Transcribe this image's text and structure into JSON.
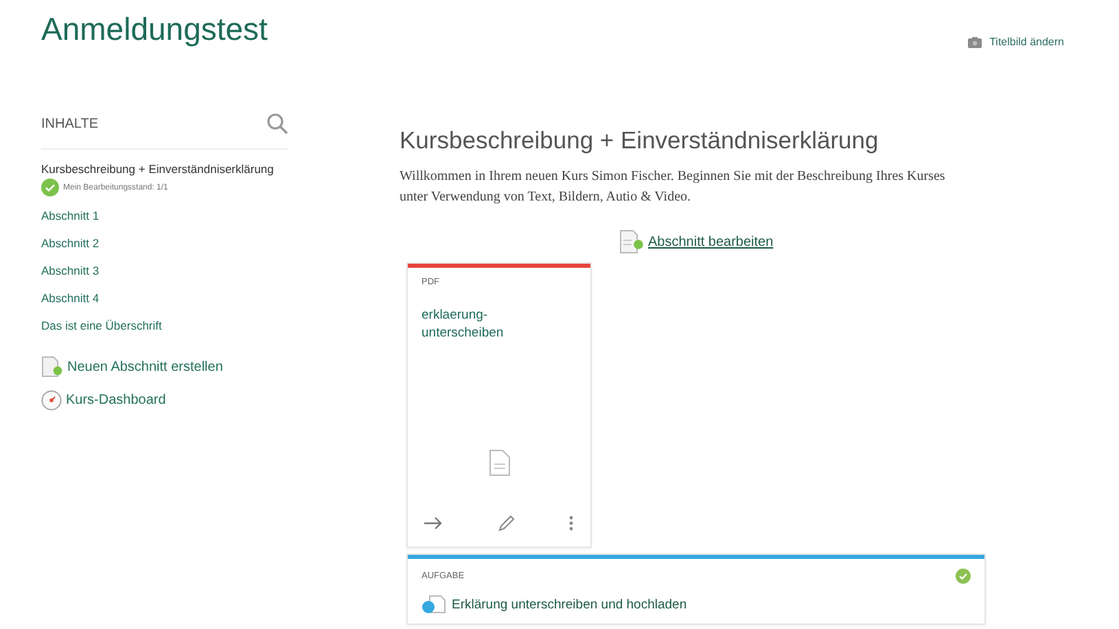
{
  "course_title": "Anmeldungstest",
  "cover_action": {
    "label": "Titelbild ändern"
  },
  "sidebar": {
    "heading": "INHALTE",
    "items": [
      {
        "label": "Kursbeschreibung + Einverständniserklärung",
        "selected": true,
        "status": "Mein Bearbeitungsstand: 1/1",
        "done": true
      },
      {
        "label": "Abschnitt 1",
        "selected": false
      },
      {
        "label": "Abschnitt 2",
        "selected": false
      },
      {
        "label": "Abschnitt 3",
        "selected": false
      },
      {
        "label": "Abschnitt 4",
        "selected": false
      },
      {
        "label": "Das ist eine Überschrift",
        "selected": false
      }
    ],
    "actions": [
      {
        "kind": "new-section",
        "label": "Neuen Abschnitt erstellen"
      },
      {
        "kind": "dashboard",
        "label": "Kurs-Dashboard"
      }
    ]
  },
  "section": {
    "title": "Kursbeschreibung + Einverständniserklärung",
    "description": "Willkommen in Ihrem neuen Kurs Simon Fischer. Beginnen Sie mit der Beschreibung Ihres Kurses unter Verwendung von Text, Bildern, Autio & Video.",
    "edit_link": "Abschnitt bearbeiten"
  },
  "cards": [
    {
      "kind": "pdf",
      "type_label": "PDF",
      "title": "erklaerung-unterscheiben",
      "color": "#e8453c",
      "done": false
    },
    {
      "kind": "task",
      "type_label": "AUFGABE",
      "title": "Erklärung unterschreiben und hochladen",
      "color": "#35a8e0",
      "done": true
    }
  ]
}
